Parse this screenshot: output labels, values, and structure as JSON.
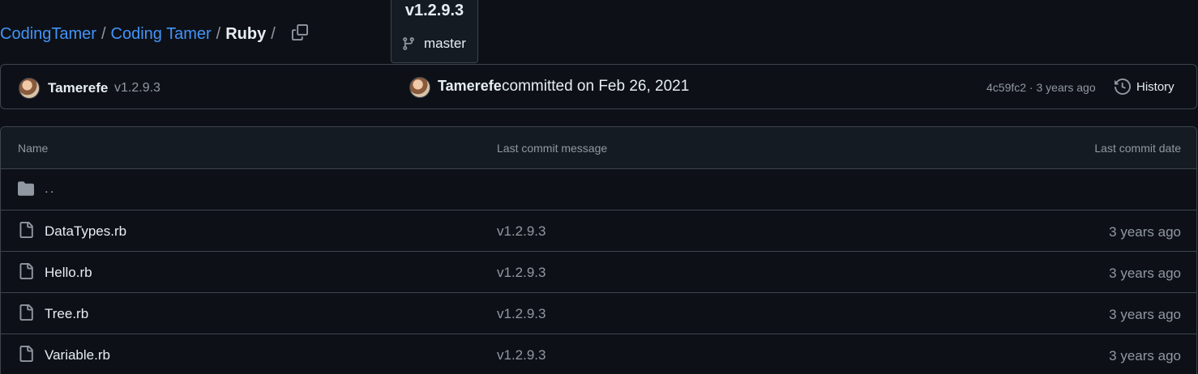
{
  "breadcrumb": {
    "owner": "CodingTamer",
    "repo": "Coding Tamer",
    "folder": "Ruby",
    "separator": "/"
  },
  "ref_picker": {
    "tag": "v1.2.9.3",
    "branch": "master"
  },
  "latest_commit": {
    "folder_author": "Tamerefe",
    "folder_tag": "v1.2.9.3",
    "author": "Tamerefe",
    "message": "committed on Feb 26, 2021",
    "sha_age": "4c59fc2 · 3 years ago",
    "history_label": "History"
  },
  "table": {
    "columns": {
      "name": "Name",
      "message": "Last commit message",
      "date": "Last commit date"
    },
    "parent_label": "..",
    "rows": [
      {
        "name": "DataTypes.rb",
        "message": "v1.2.9.3",
        "date": "3 years ago"
      },
      {
        "name": "Hello.rb",
        "message": "v1.2.9.3",
        "date": "3 years ago"
      },
      {
        "name": "Tree.rb",
        "message": "v1.2.9.3",
        "date": "3 years ago"
      },
      {
        "name": "Variable.rb",
        "message": "v1.2.9.3",
        "date": "3 years ago"
      }
    ]
  },
  "colors": {
    "background": "#0d1117",
    "link": "#4493f8",
    "muted": "#9198a1",
    "border": "#3d444d"
  },
  "icons": [
    "copy-icon",
    "git-branch-icon",
    "history-icon",
    "folder-icon",
    "file-icon"
  ]
}
